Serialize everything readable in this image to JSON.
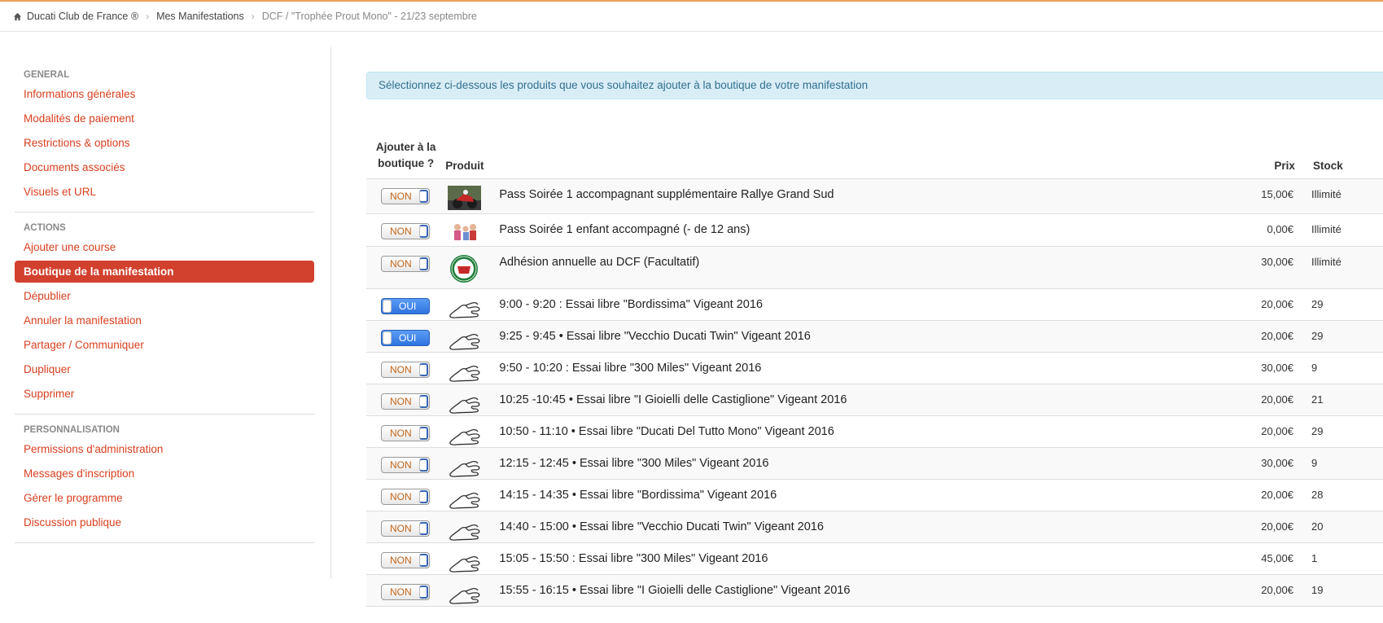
{
  "breadcrumb": {
    "items": [
      "Ducati Club de France ®",
      "Mes Manifestations",
      "DCF / \"Trophée Prout Mono\" - 21/23 septembre"
    ]
  },
  "sidebar": {
    "sections": [
      {
        "title": "GENERAL",
        "items": [
          {
            "label": "Informations générales",
            "active": false
          },
          {
            "label": "Modalités de paiement",
            "active": false
          },
          {
            "label": "Restrictions & options",
            "active": false
          },
          {
            "label": "Documents associés",
            "active": false
          },
          {
            "label": "Visuels et URL",
            "active": false
          }
        ]
      },
      {
        "title": "ACTIONS",
        "items": [
          {
            "label": "Ajouter une course",
            "active": false
          },
          {
            "label": "Boutique de la manifestation",
            "active": true
          },
          {
            "label": "Dépublier",
            "active": false
          },
          {
            "label": "Annuler la manifestation",
            "active": false
          },
          {
            "label": "Partager / Communiquer",
            "active": false
          },
          {
            "label": "Dupliquer",
            "active": false
          },
          {
            "label": "Supprimer",
            "active": false
          }
        ]
      },
      {
        "title": "PERSONNALISATION",
        "items": [
          {
            "label": "Permissions d'administration",
            "active": false
          },
          {
            "label": "Messages d'inscription",
            "active": false
          },
          {
            "label": "Gérer le programme",
            "active": false
          },
          {
            "label": "Discussion publique",
            "active": false
          }
        ]
      }
    ]
  },
  "alert": "Sélectionnez ci-dessous les produits que vous souhaitez ajouter à la boutique de votre manifestation",
  "table": {
    "headers": {
      "add_line1": "Ajouter à la",
      "add_line2": "boutique ?",
      "product": "Produit",
      "price": "Prix",
      "stock": "Stock"
    },
    "rows": [
      {
        "toggle": "NON",
        "on": false,
        "img": "moto-photo",
        "name": "Pass Soirée 1 accompagnant supplémentaire Rallye Grand Sud",
        "price": "15,00€",
        "stock": "Illimité"
      },
      {
        "toggle": "NON",
        "on": false,
        "img": "people-photo",
        "name": "Pass Soirée 1 enfant accompagné (- de 12 ans)",
        "price": "0,00€",
        "stock": "Illimité"
      },
      {
        "toggle": "NON",
        "on": false,
        "img": "club-badge",
        "name": "Adhésion annuelle au DCF (Facultatif)",
        "price": "30,00€",
        "stock": "Illimité"
      },
      {
        "toggle": "OUI",
        "on": true,
        "img": "circuit-icon",
        "name": "9:00 - 9:20 : Essai libre \"Bordissima\" Vigeant 2016",
        "price": "20,00€",
        "stock": "29"
      },
      {
        "toggle": "OUI",
        "on": true,
        "img": "circuit-icon",
        "name": "9:25 - 9:45 • Essai libre \"Vecchio Ducati Twin\" Vigeant 2016",
        "price": "20,00€",
        "stock": "29"
      },
      {
        "toggle": "NON",
        "on": false,
        "img": "circuit-icon",
        "name": "9:50 - 10:20 : Essai libre \"300 Miles\" Vigeant 2016",
        "price": "30,00€",
        "stock": "9"
      },
      {
        "toggle": "NON",
        "on": false,
        "img": "circuit-icon",
        "name": "10:25 -10:45 • Essai libre \"I Gioielli delle Castiglione\" Vigeant 2016",
        "price": "20,00€",
        "stock": "21"
      },
      {
        "toggle": "NON",
        "on": false,
        "img": "circuit-icon",
        "name": "10:50 - 11:10 • Essai libre \"Ducati Del Tutto Mono\" Vigeant 2016",
        "price": "20,00€",
        "stock": "29"
      },
      {
        "toggle": "NON",
        "on": false,
        "img": "circuit-icon",
        "name": "12:15 - 12:45 • Essai libre \"300 Miles\" Vigeant 2016",
        "price": "30,00€",
        "stock": "9"
      },
      {
        "toggle": "NON",
        "on": false,
        "img": "circuit-icon",
        "name": "14:15 - 14:35 • Essai libre \"Bordissima\" Vigeant 2016",
        "price": "20,00€",
        "stock": "28"
      },
      {
        "toggle": "NON",
        "on": false,
        "img": "circuit-icon",
        "name": "14:40 - 15:00 • Essai libre \"Vecchio Ducati Twin\" Vigeant 2016",
        "price": "20,00€",
        "stock": "20"
      },
      {
        "toggle": "NON",
        "on": false,
        "img": "circuit-icon",
        "name": "15:05 - 15:50 : Essai libre \"300 Miles\" Vigeant 2016",
        "price": "45,00€",
        "stock": "1"
      },
      {
        "toggle": "NON",
        "on": false,
        "img": "circuit-icon",
        "name": "15:55 - 16:15 • Essai libre \"I Gioielli delle Castiglione\" Vigeant 2016",
        "price": "20,00€",
        "stock": "19"
      }
    ]
  },
  "colors": {
    "accent": "#d2402e",
    "link": "#d9401f",
    "toggle_on": "#2f74e0",
    "alert_bg": "#d9edf7"
  }
}
